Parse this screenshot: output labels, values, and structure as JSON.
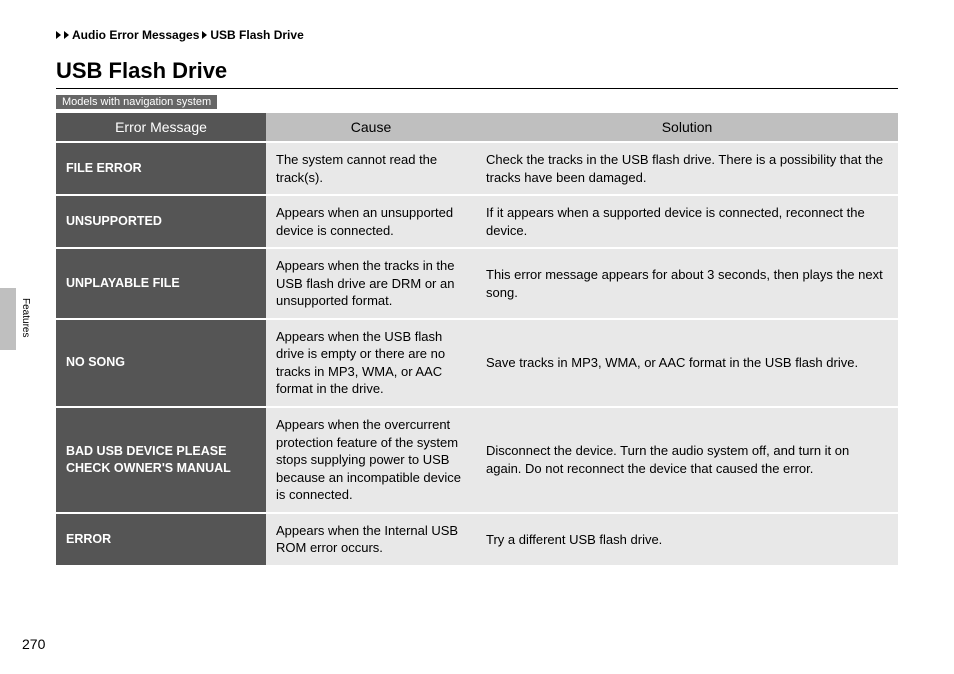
{
  "breadcrumb": {
    "level1": "Audio Error Messages",
    "level2": "USB Flash Drive"
  },
  "title": "USB Flash Drive",
  "model_note": "Models with navigation system",
  "headers": {
    "error": "Error Message",
    "cause": "Cause",
    "solution": "Solution"
  },
  "rows": [
    {
      "error": "FILE ERROR",
      "cause": "The system cannot read the track(s).",
      "solution": "Check the tracks in the USB flash drive. There is a possibility that the tracks have been damaged."
    },
    {
      "error": "UNSUPPORTED",
      "cause": "Appears when an unsupported device is connected.",
      "solution": "If it appears when a supported device is connected, reconnect the device."
    },
    {
      "error": "UNPLAYABLE FILE",
      "cause": "Appears when the tracks in the USB flash drive are DRM or an unsupported format.",
      "solution": "This error message appears for about 3 seconds, then plays the next song."
    },
    {
      "error": "NO SONG",
      "cause": "Appears when the USB flash drive is empty or there are no tracks in MP3, WMA, or AAC format in the drive.",
      "solution": "Save tracks in MP3, WMA, or AAC format in the USB flash drive."
    },
    {
      "error": "BAD USB DEVICE PLEASE CHECK OWNER'S MANUAL",
      "cause": "Appears when the overcurrent protection feature of the system stops supplying power to USB because an incompatible device is connected.",
      "solution": "Disconnect the device. Turn the audio system off, and turn it on again.\nDo not reconnect the device that caused the error."
    },
    {
      "error": "ERROR",
      "cause": "Appears when the Internal USB ROM error occurs.",
      "solution": "Try a different USB flash drive."
    }
  ],
  "side_label": "Features",
  "page_number": "270"
}
